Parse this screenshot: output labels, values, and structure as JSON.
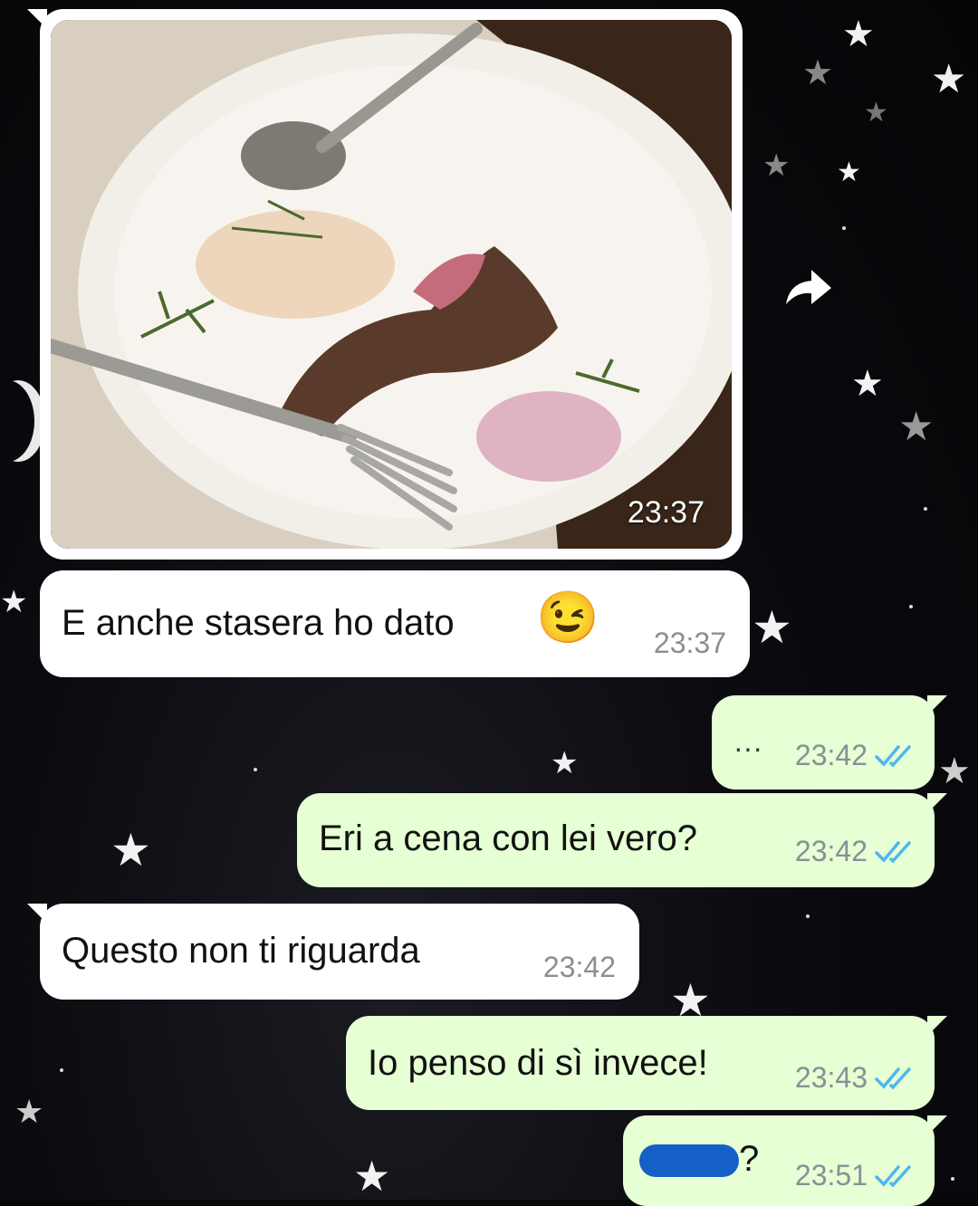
{
  "chat": {
    "photo_message": {
      "time": "23:37",
      "image_desc": "plate with leftover lamb chop, fork and spoon"
    },
    "messages": [
      {
        "side": "in",
        "text": "E anche stasera ho dato",
        "emoji": "😉",
        "time": "23:37"
      },
      {
        "side": "out",
        "text": "···",
        "time": "23:42",
        "status": "read"
      },
      {
        "side": "out",
        "text": "Eri a cena con lei vero?",
        "time": "23:42",
        "status": "read"
      },
      {
        "side": "in",
        "text": "Questo non ti riguarda",
        "time": "23:42"
      },
      {
        "side": "out",
        "text": "Io penso di sì invece!",
        "time": "23:43",
        "status": "read"
      },
      {
        "side": "out",
        "text": "?",
        "redacted": true,
        "time": "23:51",
        "status": "read"
      }
    ]
  },
  "colors": {
    "incoming_bubble": "#ffffff",
    "outgoing_bubble": "#e6ffd4",
    "read_tick": "#4fb6ec",
    "timestamp": "#8a8f94",
    "redaction": "#1560c6"
  },
  "icons": {
    "forward": "forward-arrow-icon",
    "read_status": "double-check-icon"
  }
}
